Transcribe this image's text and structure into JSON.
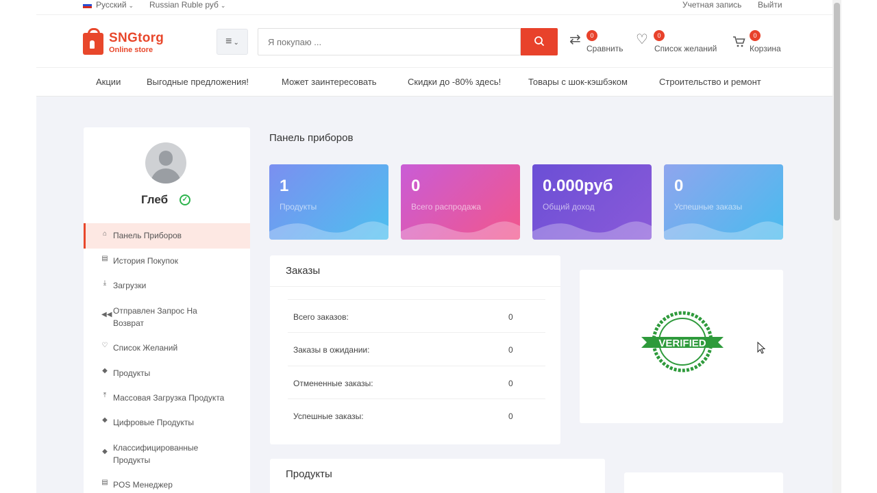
{
  "topbar": {
    "language": "Русский",
    "currency": "Russian Ruble руб",
    "account": "Учетная запись",
    "logout": "Выйти"
  },
  "logo": {
    "name": "SNGtorg",
    "tagline": "Online store",
    "brand_color": "#e8472b"
  },
  "search": {
    "placeholder": "Я покупаю ..."
  },
  "header_actions": [
    {
      "label": "Сравнить",
      "count": "0",
      "icon": "compare-icon"
    },
    {
      "label": "Список желаний",
      "count": "0",
      "icon": "heart-icon"
    },
    {
      "label": "Корзина",
      "count": "0",
      "icon": "cart-icon"
    }
  ],
  "nav": [
    "Акции",
    "Выгодные предложения!",
    "Может заинтересовать",
    "Скидки до -80% здесь!",
    "Товары с шок-кэшбэком",
    "Строительство и ремонт"
  ],
  "user": {
    "name": "Глеб"
  },
  "sidebar": [
    {
      "label": "Панель Приборов",
      "icon": "home-icon"
    },
    {
      "label": "История Покупок",
      "icon": "document-icon"
    },
    {
      "label": "Загрузки",
      "icon": "download-icon"
    },
    {
      "label": "Отправлен Запрос На Возврат",
      "icon": "return-icon"
    },
    {
      "label": "Список Желаний",
      "icon": "heart-icon"
    },
    {
      "label": "Продукты",
      "icon": "diamond-icon"
    },
    {
      "label": "Массовая Загрузка Продукта",
      "icon": "upload-icon"
    },
    {
      "label": "Цифровые Продукты",
      "icon": "diamond-icon"
    },
    {
      "label": "Классифицированные Продукты",
      "icon": "diamond-icon"
    },
    {
      "label": "POS Менеджер",
      "icon": "pos-icon"
    }
  ],
  "page_title": "Панель приборов",
  "stats": [
    {
      "value": "1",
      "label": "Продукты"
    },
    {
      "value": "0",
      "label": "Всего распродажа"
    },
    {
      "value": "0.000руб",
      "label": "Общий доход"
    },
    {
      "value": "0",
      "label": "Успешные заказы"
    }
  ],
  "orders": {
    "title": "Заказы",
    "rows": [
      {
        "label": "Всего заказов:",
        "value": "0"
      },
      {
        "label": "Заказы в ожидании:",
        "value": "0"
      },
      {
        "label": "Отмененные заказы:",
        "value": "0"
      },
      {
        "label": "Успешные заказы:",
        "value": "0"
      }
    ]
  },
  "verified": {
    "text": "VERIFIED"
  },
  "products_panel": {
    "title": "Продукты"
  }
}
